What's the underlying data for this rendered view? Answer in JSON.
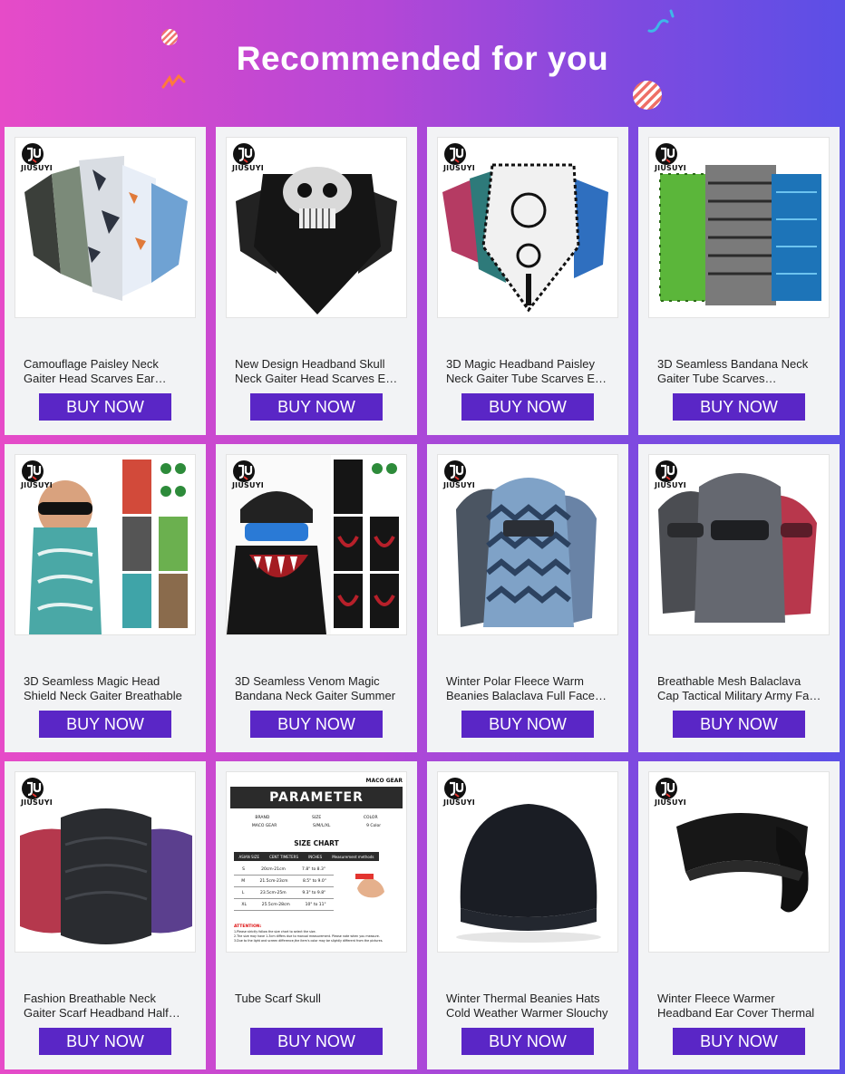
{
  "header": {
    "title": "Recommended for you"
  },
  "colors": {
    "button": "#5a26c6",
    "card": "#f2f3f5",
    "gradient_left": "#e64bc8",
    "gradient_right": "#5b4fe6"
  },
  "brand": {
    "name": "JIUSUYI"
  },
  "products": [
    {
      "name": "Camouflage Paisley Neck Gaiter Head Scarves Ear Loops",
      "button": "BUY NOW",
      "image": "camo-gaiters-image"
    },
    {
      "name": "New Design Headband Skull Neck Gaiter Head Scarves Ear Loops",
      "button": "BUY NOW",
      "image": "skull-gaiters-image"
    },
    {
      "name": "3D Magic Headband Paisley Neck Gaiter Tube Scarves Ear Loops",
      "button": "BUY NOW",
      "image": "paisley-gaiters-image"
    },
    {
      "name": "3D Seamless Bandana Neck Gaiter Tube Scarves Headband",
      "button": "BUY NOW",
      "image": "tube-scarves-image"
    },
    {
      "name": "3D Seamless Magic Head Shield Neck Gaiter Breathable",
      "button": "BUY NOW",
      "image": "head-shield-image"
    },
    {
      "name": "3D Seamless Venom Magic Bandana Neck Gaiter Summer",
      "button": "BUY NOW",
      "image": "venom-bandana-image"
    },
    {
      "name": "Winter Polar Fleece Warm Beanies Balaclava Full Face Mask",
      "button": "BUY NOW",
      "image": "fleece-balaclava-image"
    },
    {
      "name": "Breathable Mesh Balaclava Cap Tactical Military Army Face Mask",
      "button": "BUY NOW",
      "image": "mesh-balaclava-image"
    },
    {
      "name": "Fashion Breathable Neck Gaiter Scarf Headband Half Face",
      "button": "BUY NOW",
      "image": "neck-gaiter-image"
    },
    {
      "name": "Tube Scarf Skull",
      "button": "BUY NOW",
      "image": "parameter-chart-image",
      "chart": {
        "brand": "MACO GEAR",
        "heading": "PARAMETER",
        "cols": [
          "BRAND",
          "SIZE",
          "COLOR"
        ],
        "row": [
          "MACO GEAR",
          "S/M/L/XL",
          "9 Color"
        ],
        "size_title": "SIZE CHART",
        "size_cols": [
          "ASIAN SIZE",
          "CENT TIMETERS",
          "INCHES",
          "Measurement methods"
        ],
        "sizes": [
          [
            "S",
            "20cm-21cm",
            "7.8\" to 8.3\""
          ],
          [
            "M",
            "21.5cm-23cm",
            "8.5\" to 9.0\""
          ],
          [
            "L",
            "23.5cm-25m",
            "9.3\" to 9.8\""
          ],
          [
            "XL",
            "25.5cm-28cm",
            "10\" to 11\""
          ]
        ],
        "attention": "ATTENTION:",
        "notes": [
          "1.Please strictly follow the size chart to select the size.",
          "2.The size may have 1-3cm differs due to manual measurement. Please note when you measure.",
          "3.Due to the light and screen difference,the item's color may be slightly different from the pictures."
        ]
      }
    },
    {
      "name": "Winter Thermal Beanies Hats Cold Weather Warmer Slouchy",
      "button": "BUY NOW",
      "image": "beanie-image"
    },
    {
      "name": "Winter Fleece Warmer Headband Ear Cover Thermal",
      "button": "BUY NOW",
      "image": "headband-image"
    }
  ]
}
